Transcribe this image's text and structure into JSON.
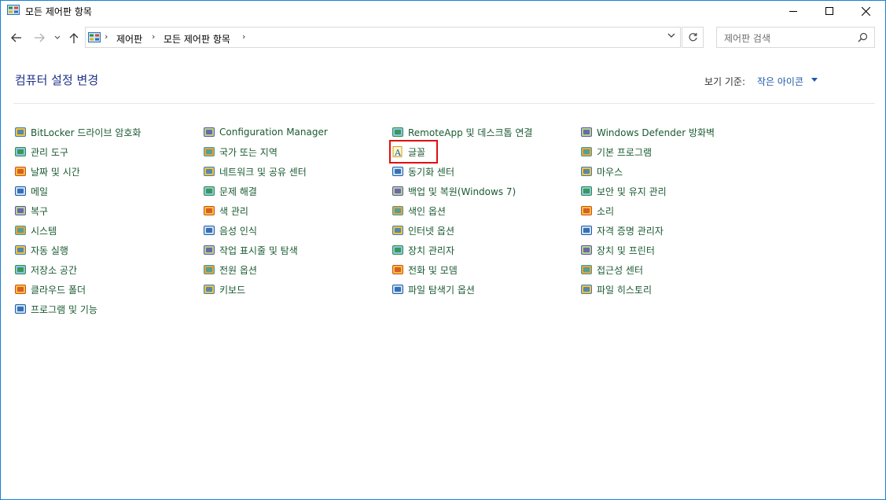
{
  "window": {
    "title": "모든 제어판 항목",
    "minimize_icon": "minimize-icon",
    "maximize_icon": "maximize-icon",
    "close_icon": "close-icon"
  },
  "nav": {
    "breadcrumb": [
      "제어판",
      "모든 제어판 항목"
    ],
    "search_placeholder": "제어판 검색"
  },
  "header": {
    "title": "컴퓨터 설정 변경",
    "view_by_label": "보기 기준:",
    "view_by_value": "작은 아이콘"
  },
  "columns": [
    [
      {
        "label": "BitLocker 드라이브 암호화",
        "icon": "bitlocker-icon"
      },
      {
        "label": "관리 도구",
        "icon": "admin-tools-icon"
      },
      {
        "label": "날짜 및 시간",
        "icon": "date-time-icon"
      },
      {
        "label": "메일",
        "icon": "mail-icon"
      },
      {
        "label": "복구",
        "icon": "recovery-icon"
      },
      {
        "label": "시스템",
        "icon": "system-icon"
      },
      {
        "label": "자동 실행",
        "icon": "autoplay-icon"
      },
      {
        "label": "저장소 공간",
        "icon": "storage-spaces-icon"
      },
      {
        "label": "클라우드 폴더",
        "icon": "work-folders-icon"
      },
      {
        "label": "프로그램 및 기능",
        "icon": "programs-features-icon"
      }
    ],
    [
      {
        "label": "Configuration Manager",
        "icon": "configuration-manager-icon"
      },
      {
        "label": "국가 또는 지역",
        "icon": "region-icon"
      },
      {
        "label": "네트워크 및 공유 센터",
        "icon": "network-icon"
      },
      {
        "label": "문제 해결",
        "icon": "troubleshooting-icon"
      },
      {
        "label": "색 관리",
        "icon": "color-management-icon"
      },
      {
        "label": "음성 인식",
        "icon": "speech-recognition-icon"
      },
      {
        "label": "작업 표시줄 및 탐색",
        "icon": "taskbar-icon"
      },
      {
        "label": "전원 옵션",
        "icon": "power-options-icon"
      },
      {
        "label": "키보드",
        "icon": "keyboard-icon"
      }
    ],
    [
      {
        "label": "RemoteApp 및 데스크톱 연결",
        "icon": "remoteapp-icon"
      },
      {
        "label": "글꼴",
        "icon": "fonts-icon"
      },
      {
        "label": "동기화 센터",
        "icon": "sync-center-icon"
      },
      {
        "label": "백업 및 복원(Windows 7)",
        "icon": "backup-restore-icon"
      },
      {
        "label": "색인 옵션",
        "icon": "indexing-options-icon"
      },
      {
        "label": "인터넷 옵션",
        "icon": "internet-options-icon"
      },
      {
        "label": "장치 관리자",
        "icon": "device-manager-icon"
      },
      {
        "label": "전화 및 모뎀",
        "icon": "phone-modem-icon"
      },
      {
        "label": "파일 탐색기 옵션",
        "icon": "file-explorer-options-icon"
      }
    ],
    [
      {
        "label": "Windows Defender 방화벽",
        "icon": "firewall-icon"
      },
      {
        "label": "기본 프로그램",
        "icon": "default-programs-icon"
      },
      {
        "label": "마우스",
        "icon": "mouse-icon"
      },
      {
        "label": "보안 및 유지 관리",
        "icon": "security-maintenance-icon"
      },
      {
        "label": "소리",
        "icon": "sound-icon"
      },
      {
        "label": "자격 증명 관리자",
        "icon": "credential-manager-icon"
      },
      {
        "label": "장치 및 프린터",
        "icon": "devices-printers-icon"
      },
      {
        "label": "접근성 센터",
        "icon": "ease-of-access-icon"
      },
      {
        "label": "파일 히스토리",
        "icon": "file-history-icon"
      }
    ]
  ],
  "colors": {
    "link_green": "#1a5a32",
    "heading_blue": "#1e3287",
    "highlight_red": "#e01010",
    "window_border": "#1883d7"
  }
}
